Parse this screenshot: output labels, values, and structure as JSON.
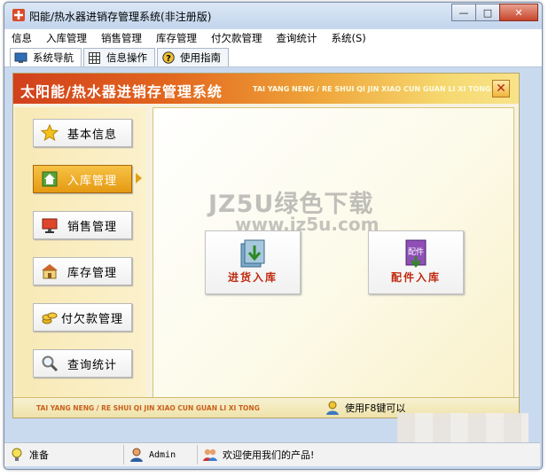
{
  "window": {
    "title": "阳能/热水器进销存管理系统(非注册版)",
    "minimize_glyph": "—",
    "maximize_glyph": "□",
    "close_glyph": "✕"
  },
  "menu": [
    "信息",
    "入库管理",
    "销售管理",
    "库存管理",
    "付欠款管理",
    "查询统计",
    "系统(S)"
  ],
  "toolbar": {
    "tabs": [
      {
        "label": "系统导航",
        "icon": "monitor-icon"
      },
      {
        "label": "信息操作",
        "icon": "grid-icon"
      },
      {
        "label": "使用指南",
        "icon": "help-icon"
      }
    ]
  },
  "panel": {
    "title": "太阳能/热水器进销存管理系统",
    "subtitle": "TAI YANG NENG / RE SHUI QI JIN XIAO CUN GUAN LI XI TONG",
    "close_glyph": "✕"
  },
  "sidebar": {
    "items": [
      {
        "label": "基本信息",
        "icon": "star-icon",
        "active": false
      },
      {
        "label": "入库管理",
        "icon": "house-icon",
        "active": true
      },
      {
        "label": "销售管理",
        "icon": "monitor-icon",
        "active": false
      },
      {
        "label": "库存管理",
        "icon": "warehouse-icon",
        "active": false
      },
      {
        "label": "付欠款管理",
        "icon": "coins-icon",
        "active": false
      },
      {
        "label": "查询统计",
        "icon": "magnifier-icon",
        "active": false
      }
    ]
  },
  "actions": [
    {
      "label": "进货入库",
      "icon": "stock-in-icon"
    },
    {
      "label": "配件入库",
      "icon": "parts-in-icon",
      "icon_text": "配件"
    }
  ],
  "watermark": {
    "line1": "JZ5U绿色下载",
    "line2": "www.jz5u.com"
  },
  "footer": {
    "text": "TAI YANG NENG / RE SHUI QI JIN XIAO CUN GUAN LI XI TONG",
    "tip": "使用F8键可以"
  },
  "statusbar": {
    "ready": "准备",
    "user": "Admin",
    "message": "欢迎使用我们的产品!"
  },
  "colors": {
    "header_start": "#d1401c",
    "header_end": "#f8e38a",
    "active_nav": "#e59a12",
    "action_label": "#c02a10"
  }
}
